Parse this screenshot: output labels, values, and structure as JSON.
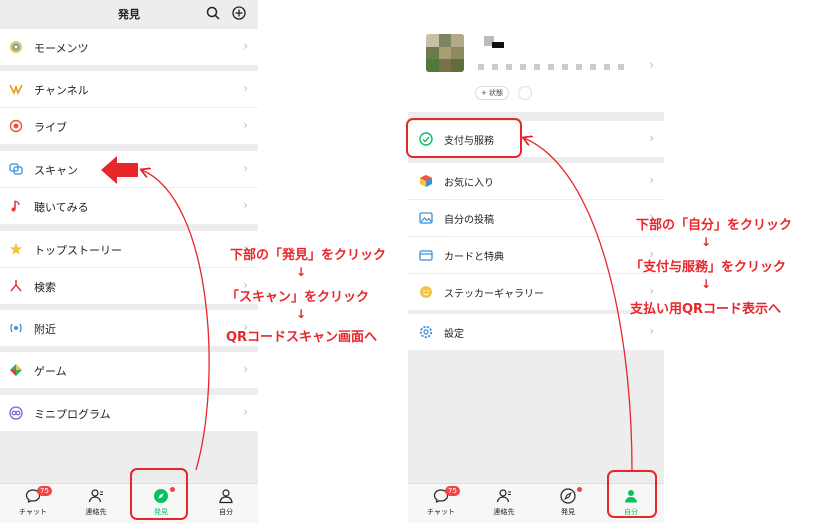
{
  "left": {
    "title": "発見",
    "menu": [
      {
        "label": "モーメンツ",
        "icon": "moments-icon"
      },
      {
        "label": "チャンネル",
        "icon": "channels-icon"
      },
      {
        "label": "ライブ",
        "icon": "live-icon"
      },
      {
        "label": "スキャン",
        "icon": "scan-icon"
      },
      {
        "label": "聴いてみる",
        "icon": "music-icon"
      },
      {
        "label": "トップストーリー",
        "icon": "top-stories-icon"
      },
      {
        "label": "検索",
        "icon": "search-feature-icon"
      },
      {
        "label": "附近",
        "icon": "nearby-icon"
      },
      {
        "label": "ゲーム",
        "icon": "games-icon"
      },
      {
        "label": "ミニプログラム",
        "icon": "mini-program-icon"
      }
    ],
    "tabs": [
      {
        "label": "チャット",
        "badge": "75"
      },
      {
        "label": "連絡先",
        "badge": ""
      },
      {
        "label": "発見",
        "badge": ""
      },
      {
        "label": "自分",
        "badge": ""
      }
    ]
  },
  "right": {
    "profile": {
      "status_label": "+ 状態"
    },
    "menu": [
      {
        "label": "支付与服務",
        "icon": "pay-icon"
      },
      {
        "label": "お気に入り",
        "icon": "favorites-icon"
      },
      {
        "label": "自分の投稿",
        "icon": "posts-icon"
      },
      {
        "label": "カードと特典",
        "icon": "cards-icon"
      },
      {
        "label": "ステッカーギャラリー",
        "icon": "sticker-icon"
      },
      {
        "label": "設定",
        "icon": "settings-icon"
      }
    ],
    "tabs": [
      {
        "label": "チャット",
        "badge": "75"
      },
      {
        "label": "連絡先",
        "badge": ""
      },
      {
        "label": "発見",
        "badge": ""
      },
      {
        "label": "自分",
        "badge": ""
      }
    ]
  },
  "annotations": {
    "left_steps": [
      "下部の「発見」をクリック",
      "↓",
      "「スキャン」をクリック",
      "↓",
      "QRコードスキャン画面へ"
    ],
    "right_steps": [
      "下部の「自分」をクリック",
      "↓",
      "「支付与服務」をクリック",
      "↓",
      "支払い用QRコード表示へ"
    ]
  },
  "colors": {
    "accent_red": "#e8262a",
    "wechat_green": "#07c160",
    "badge_red": "#f04343"
  }
}
